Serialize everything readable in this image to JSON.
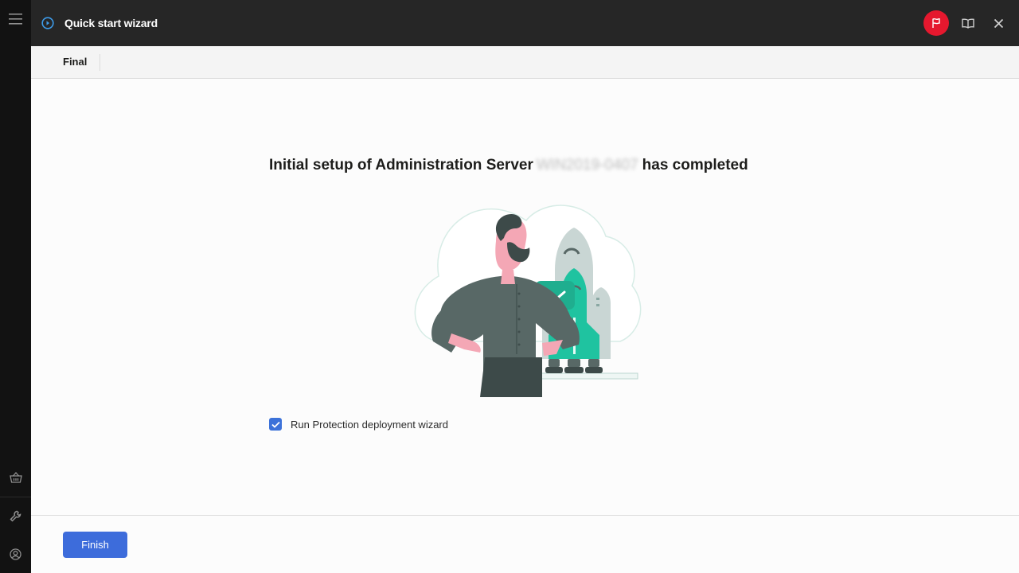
{
  "header": {
    "title": "Quick start wizard",
    "icons": {
      "wizard": "play-circle-icon",
      "flag": "flag-icon",
      "help": "book-icon",
      "close": "close-icon"
    },
    "flag_color": "#e5182e"
  },
  "sidebar": {
    "icons": [
      "menu-icon",
      "basket-icon",
      "wrench-icon",
      "user-icon"
    ]
  },
  "steps": [
    {
      "label": "Final"
    }
  ],
  "main": {
    "heading_prefix": "Initial setup of Administration Server",
    "server_name": "WIN2019-0407",
    "heading_suffix": "has completed",
    "checkbox": {
      "label": "Run Protection deployment wizard",
      "checked": true
    }
  },
  "footer": {
    "finish_label": "Finish"
  },
  "colors": {
    "accent": "#3d6cdb",
    "checkbox": "#3c72d9",
    "illustration_green": "#1fc3a0",
    "illustration_gray": "#586866"
  }
}
